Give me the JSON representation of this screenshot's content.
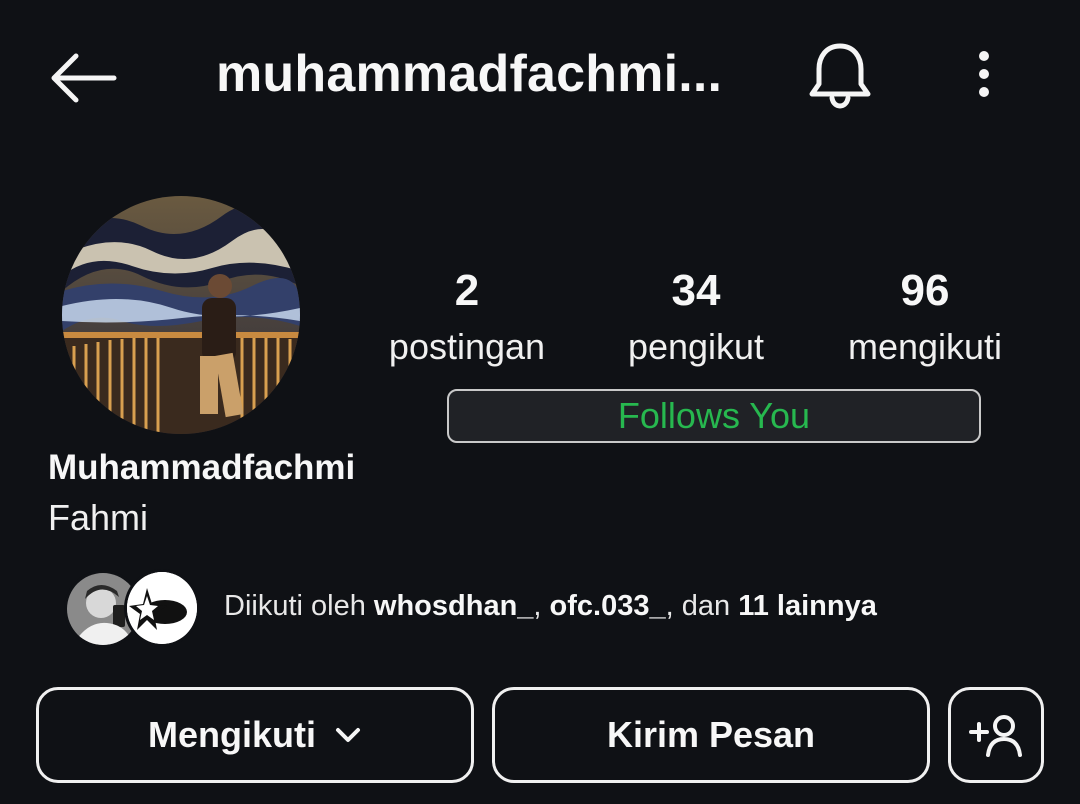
{
  "header": {
    "title": "muhammadfachmi..."
  },
  "profile": {
    "full_name": "Muhammadfachmi",
    "nickname": "Fahmi",
    "follows_you": "Follows You"
  },
  "stats": [
    {
      "value": "2",
      "label": "postingan"
    },
    {
      "value": "34",
      "label": "pengikut"
    },
    {
      "value": "96",
      "label": "mengikuti"
    }
  ],
  "followed_by": {
    "prefix": "Diikuti oleh ",
    "user1": "whosdhan_",
    "sep": ", ",
    "user2": "ofc.033_",
    "mid": ", dan ",
    "others": "11 lainnya"
  },
  "buttons": {
    "following_label": "Mengikuti",
    "message_label": "Kirim Pesan"
  },
  "colors": {
    "background": "#0f1115",
    "follows_you_text": "#27b84f"
  },
  "icons": {
    "back": "back-arrow-icon",
    "notifications": "bell-icon",
    "more": "more-vertical-icon",
    "dropdown": "chevron-down-icon",
    "suggest": "add-person-icon"
  }
}
